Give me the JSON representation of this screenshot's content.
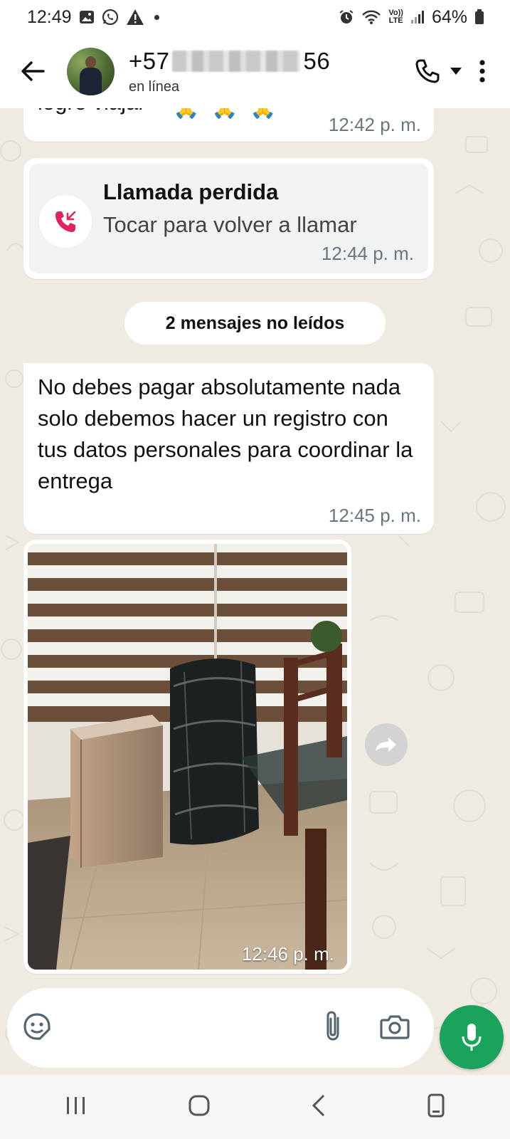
{
  "status_bar": {
    "time": "12:49",
    "battery": "64%",
    "lte_label": "LTE"
  },
  "header": {
    "contact_prefix": "+57",
    "contact_suffix": "56",
    "contact_status": "en línea"
  },
  "messages": [
    {
      "id": "m1",
      "text": "logro viajar",
      "emoji": "🙏",
      "time": "12:42 p. m."
    },
    {
      "id": "m2",
      "type": "missed_call",
      "title": "Llamada perdida",
      "subtitle": "Tocar para volver a llamar",
      "time": "12:44 p. m."
    },
    {
      "id": "m3",
      "text": "No debes pagar absolutamente nada solo debemos hacer un registro con tus datos personales para coordinar la entrega",
      "time": "12:45 p. m."
    },
    {
      "id": "m4",
      "type": "image",
      "time": "12:46 p. m."
    }
  ],
  "unread_banner": "2 mensajes no leídos",
  "colors": {
    "accent_green": "#1aa35a",
    "chat_bg": "#efeae2",
    "missed_call_red": "#e0245e"
  }
}
